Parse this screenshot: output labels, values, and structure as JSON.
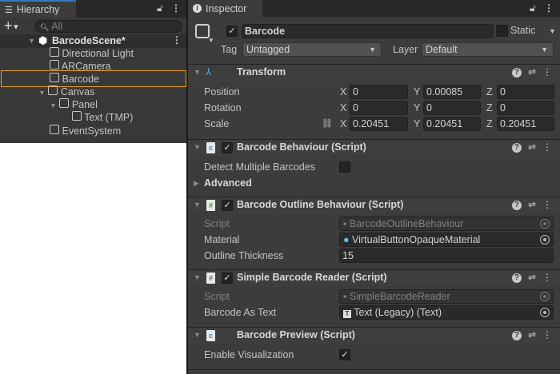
{
  "hierarchy": {
    "tab": "Hierarchy",
    "search_placeholder": "All",
    "scene": "BarcodeScene*",
    "items": [
      "Directional Light",
      "ARCamera",
      "Barcode",
      "Canvas",
      "Panel",
      "Text (TMP)",
      "EventSystem"
    ]
  },
  "inspector": {
    "tab": "Inspector",
    "object_name": "Barcode",
    "static_label": "Static",
    "tag_label": "Tag",
    "tag_value": "Untagged",
    "layer_label": "Layer",
    "layer_value": "Default",
    "transform": {
      "title": "Transform",
      "position": {
        "label": "Position",
        "x": "0",
        "y": "0.00085",
        "z": "0"
      },
      "rotation": {
        "label": "Rotation",
        "x": "0",
        "y": "0",
        "z": "0"
      },
      "scale": {
        "label": "Scale",
        "x": "0.20451",
        "y": "0.20451",
        "z": "0.20451"
      },
      "axes": [
        "X",
        "Y",
        "Z"
      ]
    },
    "barcode_behaviour": {
      "title": "Barcode Behaviour (Script)",
      "detect_label": "Detect Multiple Barcodes",
      "advanced_label": "Advanced"
    },
    "outline_behaviour": {
      "title": "Barcode Outline Behaviour (Script)",
      "script_label": "Script",
      "script_value": "BarcodeOutlineBehaviour",
      "material_label": "Material",
      "material_value": "VirtualButtonOpaqueMaterial",
      "thickness_label": "Outline Thickness",
      "thickness_value": "15"
    },
    "reader": {
      "title": "Simple Barcode Reader (Script)",
      "script_label": "Script",
      "script_value": "SimpleBarcodeReader",
      "text_label": "Barcode As Text",
      "text_value": "Text (Legacy) (Text)"
    },
    "preview": {
      "title": "Barcode Preview (Script)",
      "enable_label": "Enable Visualization"
    }
  },
  "colors": {
    "selection": "#e8a31e",
    "tab_accent": "#3a79bb"
  }
}
